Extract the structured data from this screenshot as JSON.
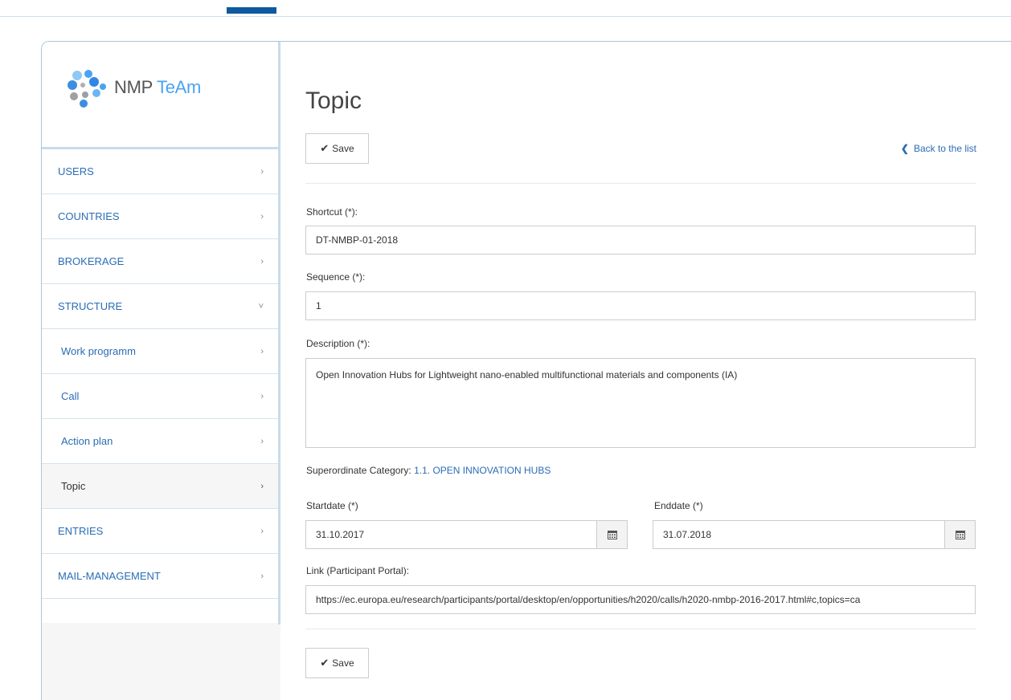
{
  "logo": {
    "name_part1": "NMP",
    "name_part2": "TeAm"
  },
  "nav": [
    {
      "label": "USERS",
      "chev": "›"
    },
    {
      "label": "COUNTRIES",
      "chev": "›"
    },
    {
      "label": "BROKERAGE",
      "chev": "›"
    },
    {
      "label": "STRUCTURE",
      "chev": "˅"
    },
    {
      "label": "Work programm",
      "chev": "›"
    },
    {
      "label": "Call",
      "chev": "›"
    },
    {
      "label": "Action plan",
      "chev": "›"
    },
    {
      "label": "Topic",
      "chev": "›"
    },
    {
      "label": "ENTRIES",
      "chev": "›"
    },
    {
      "label": "MAIL-MANAGEMENT",
      "chev": "›"
    }
  ],
  "page": {
    "title": "Topic",
    "save_label": "Save",
    "back_label": "Back to the list"
  },
  "form": {
    "shortcut_label": "Shortcut (*):",
    "shortcut_value": "DT-NMBP-01-2018",
    "sequence_label": "Sequence (*):",
    "sequence_value": "1",
    "description_label": "Description (*):",
    "description_value": "Open Innovation Hubs for Lightweight nano-enabled multifunctional materials and components (IA)",
    "category_label": "Superordinate Category:",
    "category_value": "1.1. OPEN INNOVATION HUBS",
    "startdate_label": "Startdate (*)",
    "startdate_value": "31.10.2017",
    "enddate_label": "Enddate (*)",
    "enddate_value": "31.07.2018",
    "link_label": "Link (Participant Portal):",
    "link_value": "https://ec.europa.eu/research/participants/portal/desktop/en/opportunities/h2020/calls/h2020-nmbp-2016-2017.html#c,topics=ca"
  },
  "colors": {
    "accent": "#0d5a9e",
    "link": "#2a6db5",
    "border": "#a8c6dc"
  }
}
